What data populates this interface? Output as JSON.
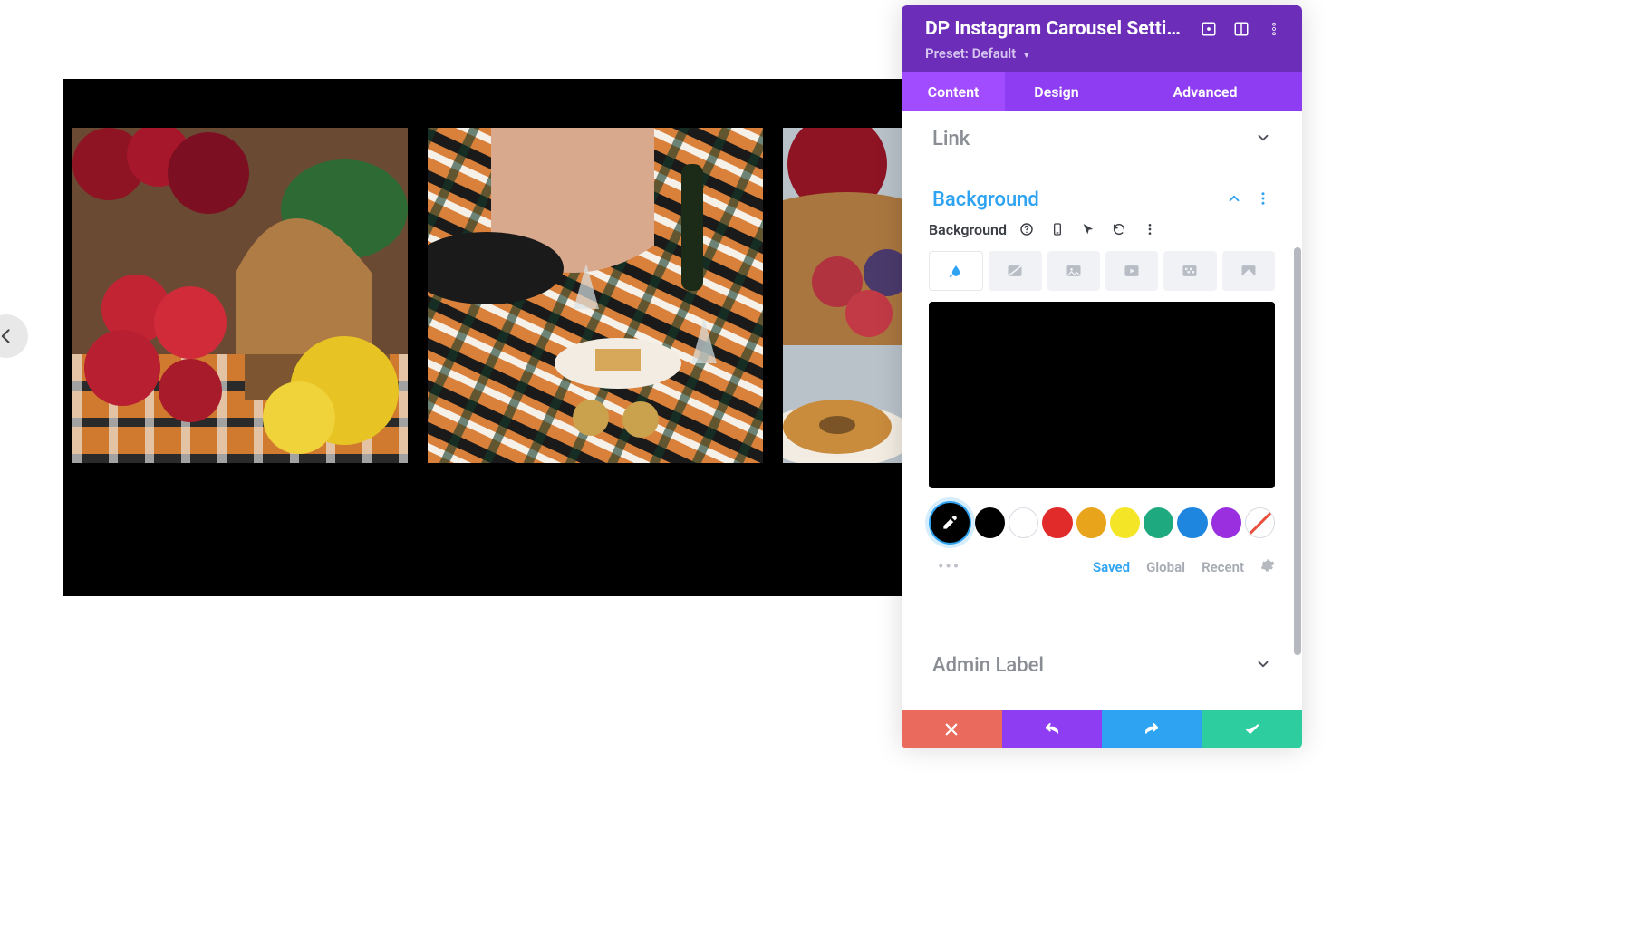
{
  "carousel": {
    "background": "#000000"
  },
  "panel": {
    "title": "DP Instagram Carousel Setti…",
    "preset_label": "Preset:",
    "preset_value": "Default",
    "tabs": [
      "Content",
      "Design",
      "Advanced"
    ],
    "active_tab": 0
  },
  "sections": {
    "link": {
      "title": "Link",
      "expanded": false
    },
    "background": {
      "title": "Background",
      "expanded": true,
      "option_label": "Background",
      "selected_bg_type": 0,
      "preview_color": "#000000",
      "palette_tabs": [
        "Saved",
        "Global",
        "Recent"
      ],
      "palette_active": 0,
      "swatches": [
        "#000000",
        "#ffffff",
        "#e12a2a",
        "#e8a41b",
        "#f4e527",
        "#1fa97e",
        "#1f86e0",
        "#9a2fe0"
      ]
    },
    "admin_label": {
      "title": "Admin Label",
      "expanded": false
    }
  },
  "footer": {
    "cancel": "cancel",
    "undo": "undo",
    "redo": "redo",
    "save": "save"
  }
}
